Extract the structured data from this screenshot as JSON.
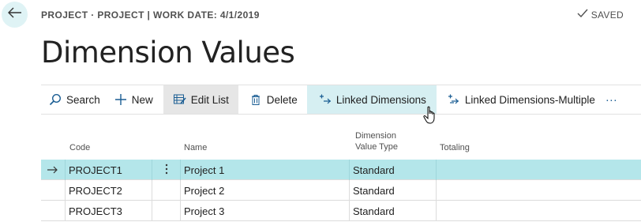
{
  "header": {
    "breadcrumb": "PROJECT · PROJECT | WORK DATE: 4/1/2019",
    "saved": "SAVED",
    "title": "Dimension Values"
  },
  "actions": {
    "search": "Search",
    "new": "New",
    "edit_list": "Edit List",
    "delete": "Delete",
    "linked_dimensions": "Linked Dimensions",
    "linked_dimensions_multiple": "Linked Dimensions-Multiple",
    "more": "···"
  },
  "columns": {
    "code": "Code",
    "name": "Name",
    "type_line1": "Dimension",
    "type_line2": "Value Type",
    "totaling": "Totaling"
  },
  "rows": [
    {
      "code": "PROJECT1",
      "name": "Project 1",
      "type": "Standard",
      "totaling": ""
    },
    {
      "code": "PROJECT2",
      "name": "Project 2",
      "type": "Standard",
      "totaling": ""
    },
    {
      "code": "PROJECT3",
      "name": "Project 3",
      "type": "Standard",
      "totaling": ""
    }
  ],
  "colors": {
    "accent_teal": "#b4e6ea",
    "back_button_bg": "#dff3f5",
    "icon_blue": "#1a5d93"
  },
  "icons": {
    "back": "back-arrow-icon",
    "saved": "checkmark-icon",
    "search": "search-icon",
    "new": "plus-icon",
    "edit_list": "edit-list-icon",
    "delete": "trash-icon",
    "linked": "linked-dimensions-icon",
    "row_selected": "arrow-right-icon",
    "row_menu": "vertical-ellipsis-icon"
  }
}
